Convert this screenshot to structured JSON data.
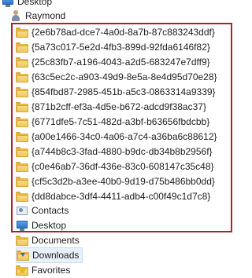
{
  "tree": {
    "desktop_label": "Desktop",
    "user_label": "Raymond",
    "guid_folders": [
      "{2e6b78ad-dce7-4a0d-8a7b-87c883243ddf}",
      "{5a73c017-5e2d-4fb3-899d-92fda6146f82}",
      "{25c83fb7-a196-4043-a2d5-683247e7dff9}",
      "{63c5ec2c-a903-49d9-8e5a-8e4d95d70e28}",
      "{854fbd87-2985-451b-a5c3-0863314a9339}",
      "{871b2cff-ef3a-4d5e-b672-adcd9f38ac37}",
      "{6771dfe5-7c51-482d-a3bf-b63656fbdcbb}",
      "{a00e1466-34c0-4a06-a7c4-a36ba6c88612}",
      "{a744b8c3-3fad-4880-b9dc-db34b8b2956f}",
      "{c0e46ab7-36df-436e-83c0-608147c35c48}",
      "{cf5c3d2b-a3ee-40b0-9d19-d75b486bb0dd}",
      "{dd8dabce-3df4-4411-adb4-c00f49c1d7c8}"
    ],
    "contacts_label": "Contacts",
    "desktop_sub_label": "Desktop",
    "documents_label": "Documents",
    "downloads_label": "Downloads",
    "favorites_label": "Favorites"
  },
  "colors": {
    "highlight_border": "#b11d2b",
    "selected_bg": "#e8f1fb"
  },
  "icons": {
    "folder": "folder-icon",
    "desktop": "desktop-icon",
    "user": "user-icon",
    "contacts": "contacts-icon",
    "downloads": "downloads-icon",
    "favorites": "favorites-icon"
  }
}
